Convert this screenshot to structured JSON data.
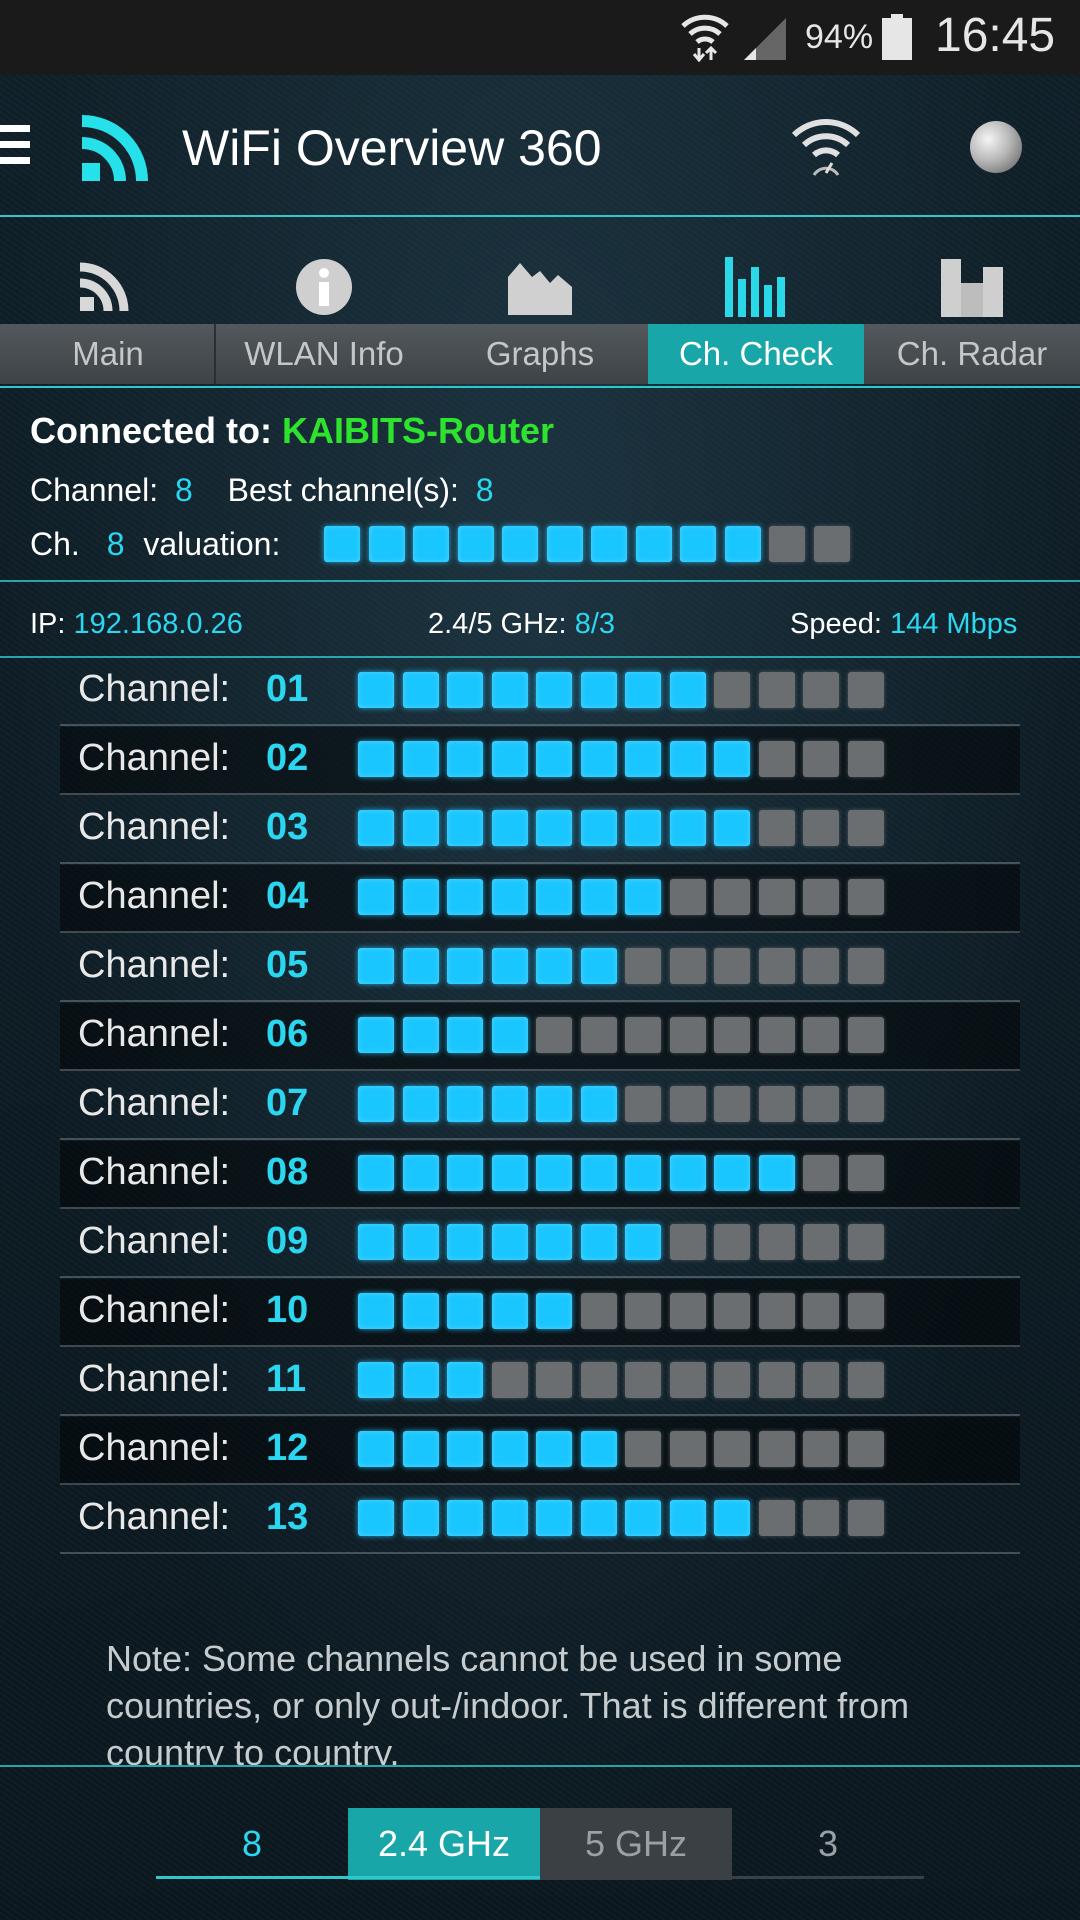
{
  "status_bar": {
    "battery": "94%",
    "time": "16:45"
  },
  "app": {
    "title": "WiFi Overview 360"
  },
  "tabs": [
    {
      "label": "Main",
      "icon": "rss-icon",
      "active": false
    },
    {
      "label": "WLAN Info",
      "icon": "info-icon",
      "active": false
    },
    {
      "label": "Graphs",
      "icon": "graphs-icon",
      "active": false
    },
    {
      "label": "Ch. Check",
      "icon": "bars-icon",
      "active": true
    },
    {
      "label": "Ch. Radar",
      "icon": "radar-icon",
      "active": false
    }
  ],
  "connection": {
    "label": "Connected to:",
    "ssid": "KAIBITS-Router",
    "channel_label": "Channel:",
    "channel": "8",
    "best_label": "Best channel(s):",
    "best": "8",
    "valuation_prefix": "Ch.",
    "valuation_channel": "8",
    "valuation_label": "valuation:",
    "valuation_level": 10,
    "valuation_max": 12
  },
  "ip_row": {
    "ip_label": "IP:",
    "ip": "192.168.0.26",
    "band_label": "2.4/5 GHz:",
    "band": "8/3",
    "speed_label": "Speed:",
    "speed": "144 Mbps"
  },
  "channel_label": "Channel:",
  "channels": [
    {
      "num": "01",
      "level": 8
    },
    {
      "num": "02",
      "level": 9
    },
    {
      "num": "03",
      "level": 9
    },
    {
      "num": "04",
      "level": 7
    },
    {
      "num": "05",
      "level": 6
    },
    {
      "num": "06",
      "level": 4
    },
    {
      "num": "07",
      "level": 6
    },
    {
      "num": "08",
      "level": 10
    },
    {
      "num": "09",
      "level": 7
    },
    {
      "num": "10",
      "level": 5
    },
    {
      "num": "11",
      "level": 3
    },
    {
      "num": "12",
      "level": 6
    },
    {
      "num": "13",
      "level": 9
    }
  ],
  "level_max": 12,
  "note": "Note: Some channels cannot be used in some countries, or only out-/indoor. That is different from country to country.",
  "bottom": {
    "count_24": "8",
    "tab_24": "2.4 GHz",
    "tab_5": "5 GHz",
    "count_5": "3",
    "active": "2.4 GHz"
  },
  "colors": {
    "accent": "#2ec7cc",
    "active_tab": "#19a6a9",
    "ssid": "#2ee32e",
    "value": "#2bd6f0",
    "bar_on": "#19c6ff",
    "bar_off": "#6a6e70"
  }
}
